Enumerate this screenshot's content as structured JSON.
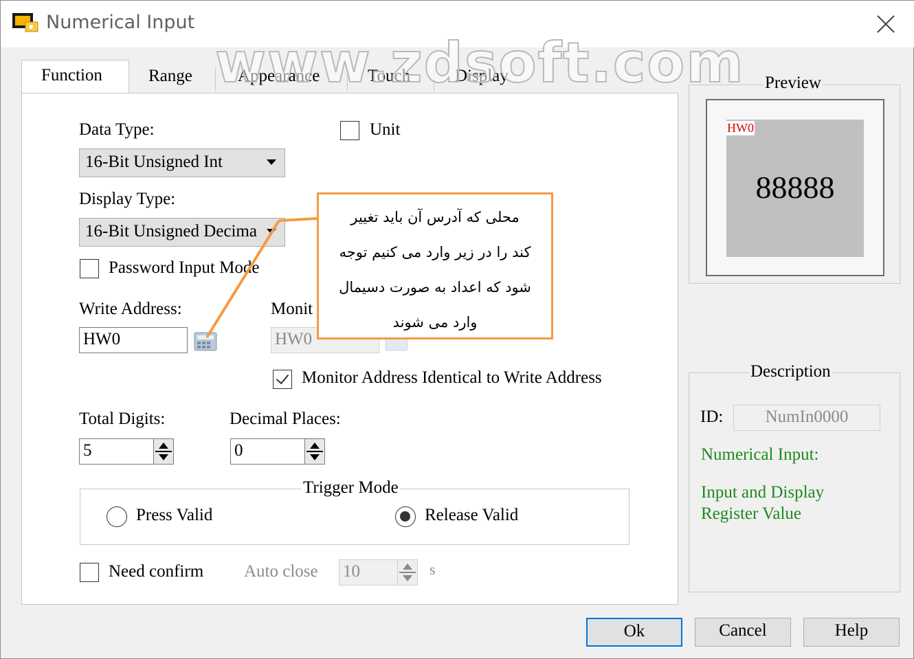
{
  "window": {
    "title": "Numerical Input",
    "watermark": "www.zdsoft.com"
  },
  "tabs": [
    {
      "label": "Function",
      "active": true
    },
    {
      "label": "Range"
    },
    {
      "label": "Appearance"
    },
    {
      "label": "Touch"
    },
    {
      "label": "Display"
    }
  ],
  "function": {
    "data_type_label": "Data Type:",
    "data_type_value": "16-Bit Unsigned Int",
    "unit_label": "Unit",
    "display_type_label": "Display Type:",
    "display_type_value": "16-Bit Unsigned Decima",
    "password_label": "Password Input Mode",
    "write_address_label": "Write Address:",
    "write_address_value": "HW0",
    "monitor_label": "Monit",
    "monitor_address_value": "HW0",
    "monitor_identical_label": "Monitor Address Identical to Write Address",
    "total_digits_label": "Total Digits:",
    "total_digits_value": "5",
    "decimal_places_label": "Decimal Places:",
    "decimal_places_value": "0",
    "trigger_mode_title": "Trigger Mode",
    "press_valid_label": "Press Valid",
    "release_valid_label": "Release Valid",
    "need_confirm_label": "Need confirm",
    "auto_close_label": "Auto close",
    "auto_close_value": "10",
    "auto_close_unit": "s"
  },
  "preview": {
    "title": "Preview",
    "address_tag": "HW0",
    "value": "88888"
  },
  "description": {
    "title": "Description",
    "id_label": "ID:",
    "id_value": "NumIn0000",
    "type_label": "Numerical Input:",
    "text_line1": "Input and Display",
    "text_line2": "Register Value"
  },
  "buttons": {
    "ok": "Ok",
    "cancel": "Cancel",
    "help": "Help"
  },
  "annotation": {
    "line1": "محلی که آدرس آن باید تغییر",
    "line2": "کند را در زیر وارد می کنیم توجه",
    "line3": "شود که اعداد به صورت دسیمال",
    "line4": "وارد می شوند"
  },
  "colors": {
    "accent": "#0078d7",
    "annotation": "#f59a42",
    "description_text": "#1d8a1d",
    "preview_tag": "#e00000"
  }
}
